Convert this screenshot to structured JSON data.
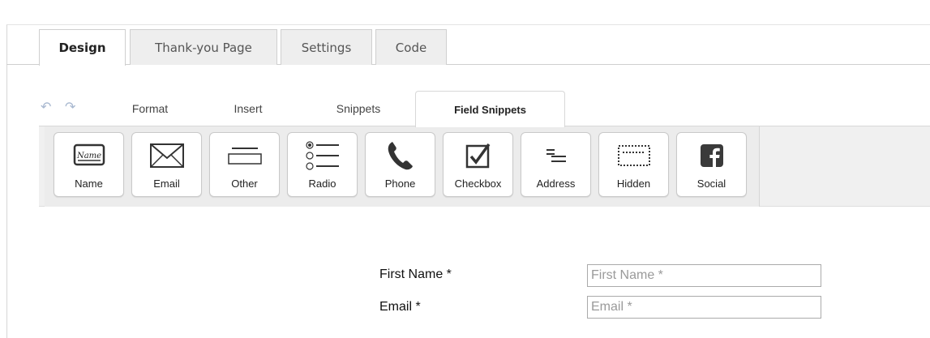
{
  "top_tabs": [
    {
      "label": "Design",
      "active": true
    },
    {
      "label": "Thank-you Page",
      "active": false
    },
    {
      "label": "Settings",
      "active": false
    },
    {
      "label": "Code",
      "active": false
    }
  ],
  "toolbar": {
    "undo_icon": "undo-icon",
    "redo_icon": "redo-icon",
    "menu_tabs": [
      {
        "label": "Format"
      },
      {
        "label": "Insert"
      },
      {
        "label": "Snippets"
      },
      {
        "label": "Field Snippets",
        "active": true
      }
    ]
  },
  "field_snippets": [
    {
      "label": "Name",
      "icon": "name-tag-icon"
    },
    {
      "label": "Email",
      "icon": "envelope-icon"
    },
    {
      "label": "Other",
      "icon": "text-field-icon"
    },
    {
      "label": "Radio",
      "icon": "radio-list-icon"
    },
    {
      "label": "Phone",
      "icon": "phone-icon"
    },
    {
      "label": "Checkbox",
      "icon": "checkbox-icon"
    },
    {
      "label": "Address",
      "icon": "address-lines-icon"
    },
    {
      "label": "Hidden",
      "icon": "hidden-field-icon"
    },
    {
      "label": "Social",
      "icon": "facebook-icon"
    }
  ],
  "form": {
    "fields": [
      {
        "label": "First Name *",
        "placeholder": "First Name *",
        "value": ""
      },
      {
        "label": "Email *",
        "placeholder": "Email *",
        "value": ""
      }
    ]
  },
  "colors": {
    "accent_icon": "#a8b8d0",
    "tab_inactive_bg": "#eeeeee",
    "snippet_bar_bg": "#f0f0f0"
  }
}
